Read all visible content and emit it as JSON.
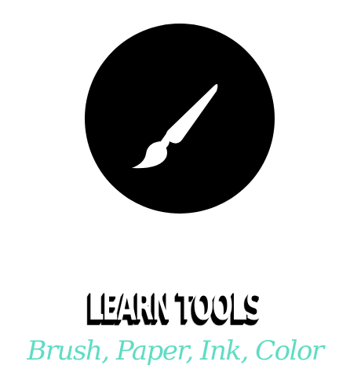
{
  "card": {
    "icon": "paintbrush-icon",
    "title": "LEARN TOOLS",
    "subtitle": "Brush, Paper, Ink, Color"
  },
  "colors": {
    "circle": "#000000",
    "title_fill": "#ffffff",
    "title_shadow": "#000000",
    "subtitle": "#5fdcc4"
  }
}
